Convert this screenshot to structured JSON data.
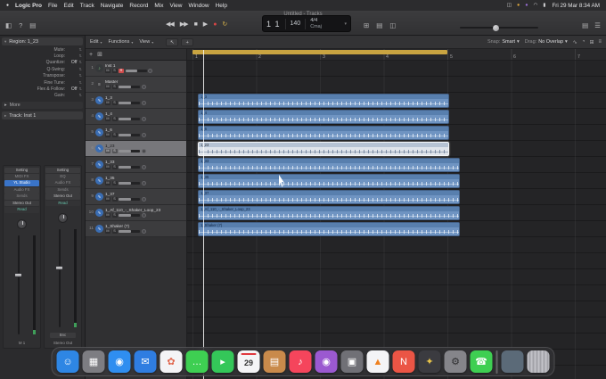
{
  "colors": {
    "accent_blue": "#3a74c8",
    "region_blue": "#6f94c2",
    "selected_region": "#dfe4eb",
    "cycle_yellow": "#c9a441",
    "record_red": "#d64545"
  },
  "menu_bar": {
    "apple_glyph": "●",
    "items": [
      {
        "label": "Logic Pro",
        "cls": "bold"
      },
      {
        "label": "File",
        "cls": ""
      },
      {
        "label": "Edit",
        "cls": ""
      },
      {
        "label": "Track",
        "cls": ""
      },
      {
        "label": "Navigate",
        "cls": ""
      },
      {
        "label": "Record",
        "cls": ""
      },
      {
        "label": "Mix",
        "cls": ""
      },
      {
        "label": "View",
        "cls": ""
      },
      {
        "label": "Window",
        "cls": ""
      },
      {
        "label": "Help",
        "cls": ""
      }
    ],
    "status_icons": [
      {
        "glyph": "◫",
        "name": "display-icon",
        "cls": ""
      },
      {
        "glyph": "●",
        "name": "screen-record-icon",
        "cls": "orange"
      },
      {
        "glyph": "●",
        "name": "logic-status-icon",
        "cls": "purple"
      },
      {
        "glyph": "◠",
        "name": "wifi-icon",
        "cls": ""
      },
      {
        "glyph": "▮",
        "name": "battery-icon",
        "cls": ""
      }
    ],
    "clock": "Fri 29 Mar  8:34 AM"
  },
  "window": {
    "title": "Untitled - Tracks"
  },
  "toolbar": {
    "left_icons": [
      {
        "glyph": "◧",
        "name": "inspector-toggle-button"
      },
      {
        "glyph": "?",
        "name": "quick-help-button"
      },
      {
        "glyph": "▤",
        "name": "library-toggle-button"
      }
    ],
    "transport": [
      {
        "glyph": "◀◀",
        "name": "rewind-button",
        "cls": ""
      },
      {
        "glyph": "▶▶",
        "name": "forward-button",
        "cls": ""
      },
      {
        "glyph": "■",
        "name": "stop-button",
        "cls": ""
      },
      {
        "glyph": "▶",
        "name": "play-button",
        "cls": ""
      },
      {
        "glyph": "●",
        "name": "record-button",
        "cls": "rec"
      },
      {
        "glyph": "↻",
        "name": "cycle-button",
        "cls": "cycle"
      }
    ],
    "lcd": {
      "position": "1 1",
      "tempo": "140",
      "time_sig": "4/4",
      "key": "Cmaj",
      "chevron": "▾"
    },
    "right_icons_1": [
      {
        "glyph": "⊞",
        "name": "smart-controls-button"
      },
      {
        "glyph": "▤",
        "name": "mixer-button"
      },
      {
        "glyph": "◫",
        "name": "editors-button"
      }
    ],
    "right_icons_2": [
      {
        "glyph": "▤",
        "name": "list-editors-button"
      },
      {
        "glyph": "☰",
        "name": "browser-button"
      }
    ]
  },
  "inspector": {
    "region_header": "Region: 1_23",
    "region_params": [
      {
        "label": "Mute:",
        "value": ""
      },
      {
        "label": "Loop:",
        "value": ""
      },
      {
        "label": "Quantize:",
        "value": "Off"
      },
      {
        "label": "Q-Swing:",
        "value": ""
      },
      {
        "label": "Transpose:",
        "value": ""
      },
      {
        "label": "Fine Tune:",
        "value": ""
      },
      {
        "label": "Flex & Follow:",
        "value": "Off"
      },
      {
        "label": "Gain:",
        "value": ""
      }
    ],
    "more_label": "More",
    "track_header": "Track: Inst 1",
    "strip1_buttons": [
      {
        "label": "Setting",
        "cls": ""
      },
      {
        "label": "MIDI FX",
        "cls": "dim"
      },
      {
        "label": "YL Studio",
        "cls": "active"
      },
      {
        "label": "Audio FX",
        "cls": "dim"
      },
      {
        "label": "Sends",
        "cls": "dim"
      },
      {
        "label": "Stereo Out",
        "cls": ""
      },
      {
        "label": "Read",
        "cls": "auto"
      }
    ],
    "strip2_buttons": [
      {
        "label": "Setting",
        "cls": ""
      },
      {
        "label": "EQ",
        "cls": "dim"
      },
      {
        "label": "Audio FX",
        "cls": "dim"
      },
      {
        "label": "Sends",
        "cls": "dim"
      },
      {
        "label": "Stereo Out",
        "cls": ""
      },
      {
        "label": "Read",
        "cls": "auto"
      }
    ],
    "strip1_footer": "M 1",
    "strip2_footer": "Stereo Out",
    "bounce_label": "Bnc"
  },
  "pane_toolbar": {
    "menus": [
      {
        "label": "Edit",
        "name": "edit-menu-button"
      },
      {
        "label": "Functions",
        "name": "functions-menu-button"
      },
      {
        "label": "View",
        "name": "view-menu-button"
      }
    ],
    "tools": [
      {
        "glyph": "↖",
        "name": "left-click-tool-button"
      },
      {
        "glyph": "+",
        "name": "command-click-tool-button"
      }
    ],
    "snap_label": "Snap:",
    "snap_value": "Smart",
    "drag_label": "Drag:",
    "drag_value": "No Overlap",
    "right_icons": [
      {
        "glyph": "∿",
        "name": "flex-button"
      },
      {
        "glyph": "◔",
        "name": "catch-playhead-button"
      },
      {
        "glyph": "⊞",
        "name": "zoom-presets-button"
      },
      {
        "glyph": "≡",
        "name": "more-options-button"
      }
    ]
  },
  "track_list_header": {
    "icons": [
      {
        "glyph": "+",
        "name": "add-track-button"
      },
      {
        "glyph": "⊞",
        "name": "duplicate-track-button"
      }
    ]
  },
  "ruler": {
    "bars": [
      "1",
      "2",
      "3",
      "4",
      "5",
      "6",
      "7"
    ]
  },
  "tracks": [
    {
      "num": "1",
      "name": "Inst 1",
      "icon": "icon-inst",
      "glyph": "♪",
      "m": "M",
      "s": "S",
      "r": "R",
      "state": ""
    },
    {
      "num": "2",
      "name": "Master",
      "icon": "icon-master",
      "glyph": "≡",
      "m": "M",
      "s": "S",
      "r": "",
      "state": ""
    },
    {
      "num": "3",
      "name": "1_3",
      "icon": "icon-audio",
      "glyph": "∿",
      "m": "M",
      "s": "S",
      "r": "",
      "state": ""
    },
    {
      "num": "4",
      "name": "1_4",
      "icon": "icon-audio",
      "glyph": "∿",
      "m": "M",
      "s": "S",
      "r": "",
      "state": ""
    },
    {
      "num": "5",
      "name": "1_6",
      "icon": "icon-audio",
      "glyph": "∿",
      "m": "M",
      "s": "S",
      "r": "",
      "state": ""
    },
    {
      "num": "6",
      "name": "1_23",
      "icon": "icon-audio",
      "glyph": "∿",
      "m": "M",
      "s": "S",
      "r": "",
      "state": "selected"
    },
    {
      "num": "7",
      "name": "1_33",
      "icon": "icon-audio",
      "glyph": "∿",
      "m": "M",
      "s": "S",
      "r": "",
      "state": ""
    },
    {
      "num": "8",
      "name": "1_35",
      "icon": "icon-audio",
      "glyph": "∿",
      "m": "M",
      "s": "S",
      "r": "",
      "state": ""
    },
    {
      "num": "9",
      "name": "1_37",
      "icon": "icon-audio",
      "glyph": "∿",
      "m": "M",
      "s": "S",
      "r": "",
      "state": ""
    },
    {
      "num": "10",
      "name": "1_Af_110_-_Shaker_Loop_23",
      "icon": "icon-audio",
      "glyph": "∿",
      "m": "M",
      "s": "S",
      "r": "",
      "state": ""
    },
    {
      "num": "11",
      "name": "1_Shaker (7)",
      "icon": "icon-audio",
      "glyph": "∿",
      "m": "M",
      "s": "S",
      "r": "",
      "state": ""
    }
  ],
  "regions": [
    {
      "label": "1_3",
      "cls": "short"
    },
    {
      "label": "1_4",
      "cls": "short"
    },
    {
      "label": "1_6",
      "cls": "short"
    },
    {
      "label": "1_23",
      "cls": "short selected"
    },
    {
      "label": "1_33",
      "cls": "long"
    },
    {
      "label": "1_35",
      "cls": "long"
    },
    {
      "label": "1_37",
      "cls": "long"
    },
    {
      "label": "1_Af_110_-_Shaker_Loop_23",
      "cls": "long"
    },
    {
      "label": "1_Shaker (7)",
      "cls": "long"
    }
  ],
  "dock": [
    {
      "name": "dock-finder-icon",
      "glyph": "☺",
      "color": "#2e86e4",
      "glyph_color": "",
      "variant": ""
    },
    {
      "name": "dock-launchpad-icon",
      "glyph": "▦",
      "color": "#7d7d82",
      "glyph_color": "",
      "variant": ""
    },
    {
      "name": "dock-safari-icon",
      "glyph": "◉",
      "color": "#2f8ef0",
      "glyph_color": "",
      "variant": ""
    },
    {
      "name": "dock-mail-icon",
      "glyph": "✉",
      "color": "#2f7de1",
      "glyph_color": "",
      "variant": ""
    },
    {
      "name": "dock-photos-icon",
      "glyph": "✿",
      "color": "#f4f4f6",
      "glyph_color": "#e0674e",
      "variant": ""
    },
    {
      "name": "dock-messages-icon",
      "glyph": "…",
      "color": "#3ecf52",
      "glyph_color": "",
      "variant": ""
    },
    {
      "name": "dock-facetime-icon",
      "glyph": "▸",
      "color": "#34c759",
      "glyph_color": "",
      "variant": ""
    },
    {
      "name": "dock-calendar-icon",
      "glyph": "29",
      "color": "#f4f4f6",
      "glyph_color": "#333333",
      "variant": "calendar"
    },
    {
      "name": "dock-notes-icon",
      "glyph": "▤",
      "color": "#c98a4b",
      "glyph_color": "",
      "variant": ""
    },
    {
      "name": "dock-music-icon",
      "glyph": "♪",
      "color": "#f5455c",
      "glyph_color": "",
      "variant": ""
    },
    {
      "name": "dock-podcasts-icon",
      "glyph": "◉",
      "color": "#9b59d0",
      "glyph_color": "",
      "variant": ""
    },
    {
      "name": "dock-photo-booth-icon",
      "glyph": "▣",
      "color": "#707076",
      "glyph_color": "",
      "variant": ""
    },
    {
      "name": "dock-vlc-icon",
      "glyph": "▲",
      "color": "#f4f4f6",
      "glyph_color": "#ef8120",
      "variant": ""
    },
    {
      "name": "dock-news-icon",
      "glyph": "N",
      "color": "#eb5545",
      "glyph_color": "",
      "variant": ""
    },
    {
      "name": "dock-game-center-icon",
      "glyph": "✦",
      "color": "#3b3b40",
      "glyph_color": "#e8c44a",
      "variant": ""
    },
    {
      "name": "dock-settings-icon",
      "glyph": "⚙",
      "color": "#85858a",
      "glyph_color": "#2e2e30",
      "variant": ""
    },
    {
      "name": "dock-phone-icon",
      "glyph": "☎",
      "color": "#3ecf52",
      "glyph_color": "",
      "variant": ""
    },
    {
      "name": "dock-separator",
      "glyph": "",
      "color": "",
      "glyph_color": "",
      "variant": "separator"
    },
    {
      "name": "dock-minimized-window-icon",
      "glyph": "",
      "color": "#5b6a78",
      "glyph_color": "",
      "variant": "window"
    },
    {
      "name": "dock-trash-icon",
      "glyph": "",
      "color": "",
      "glyph_color": "",
      "variant": "trash"
    }
  ]
}
